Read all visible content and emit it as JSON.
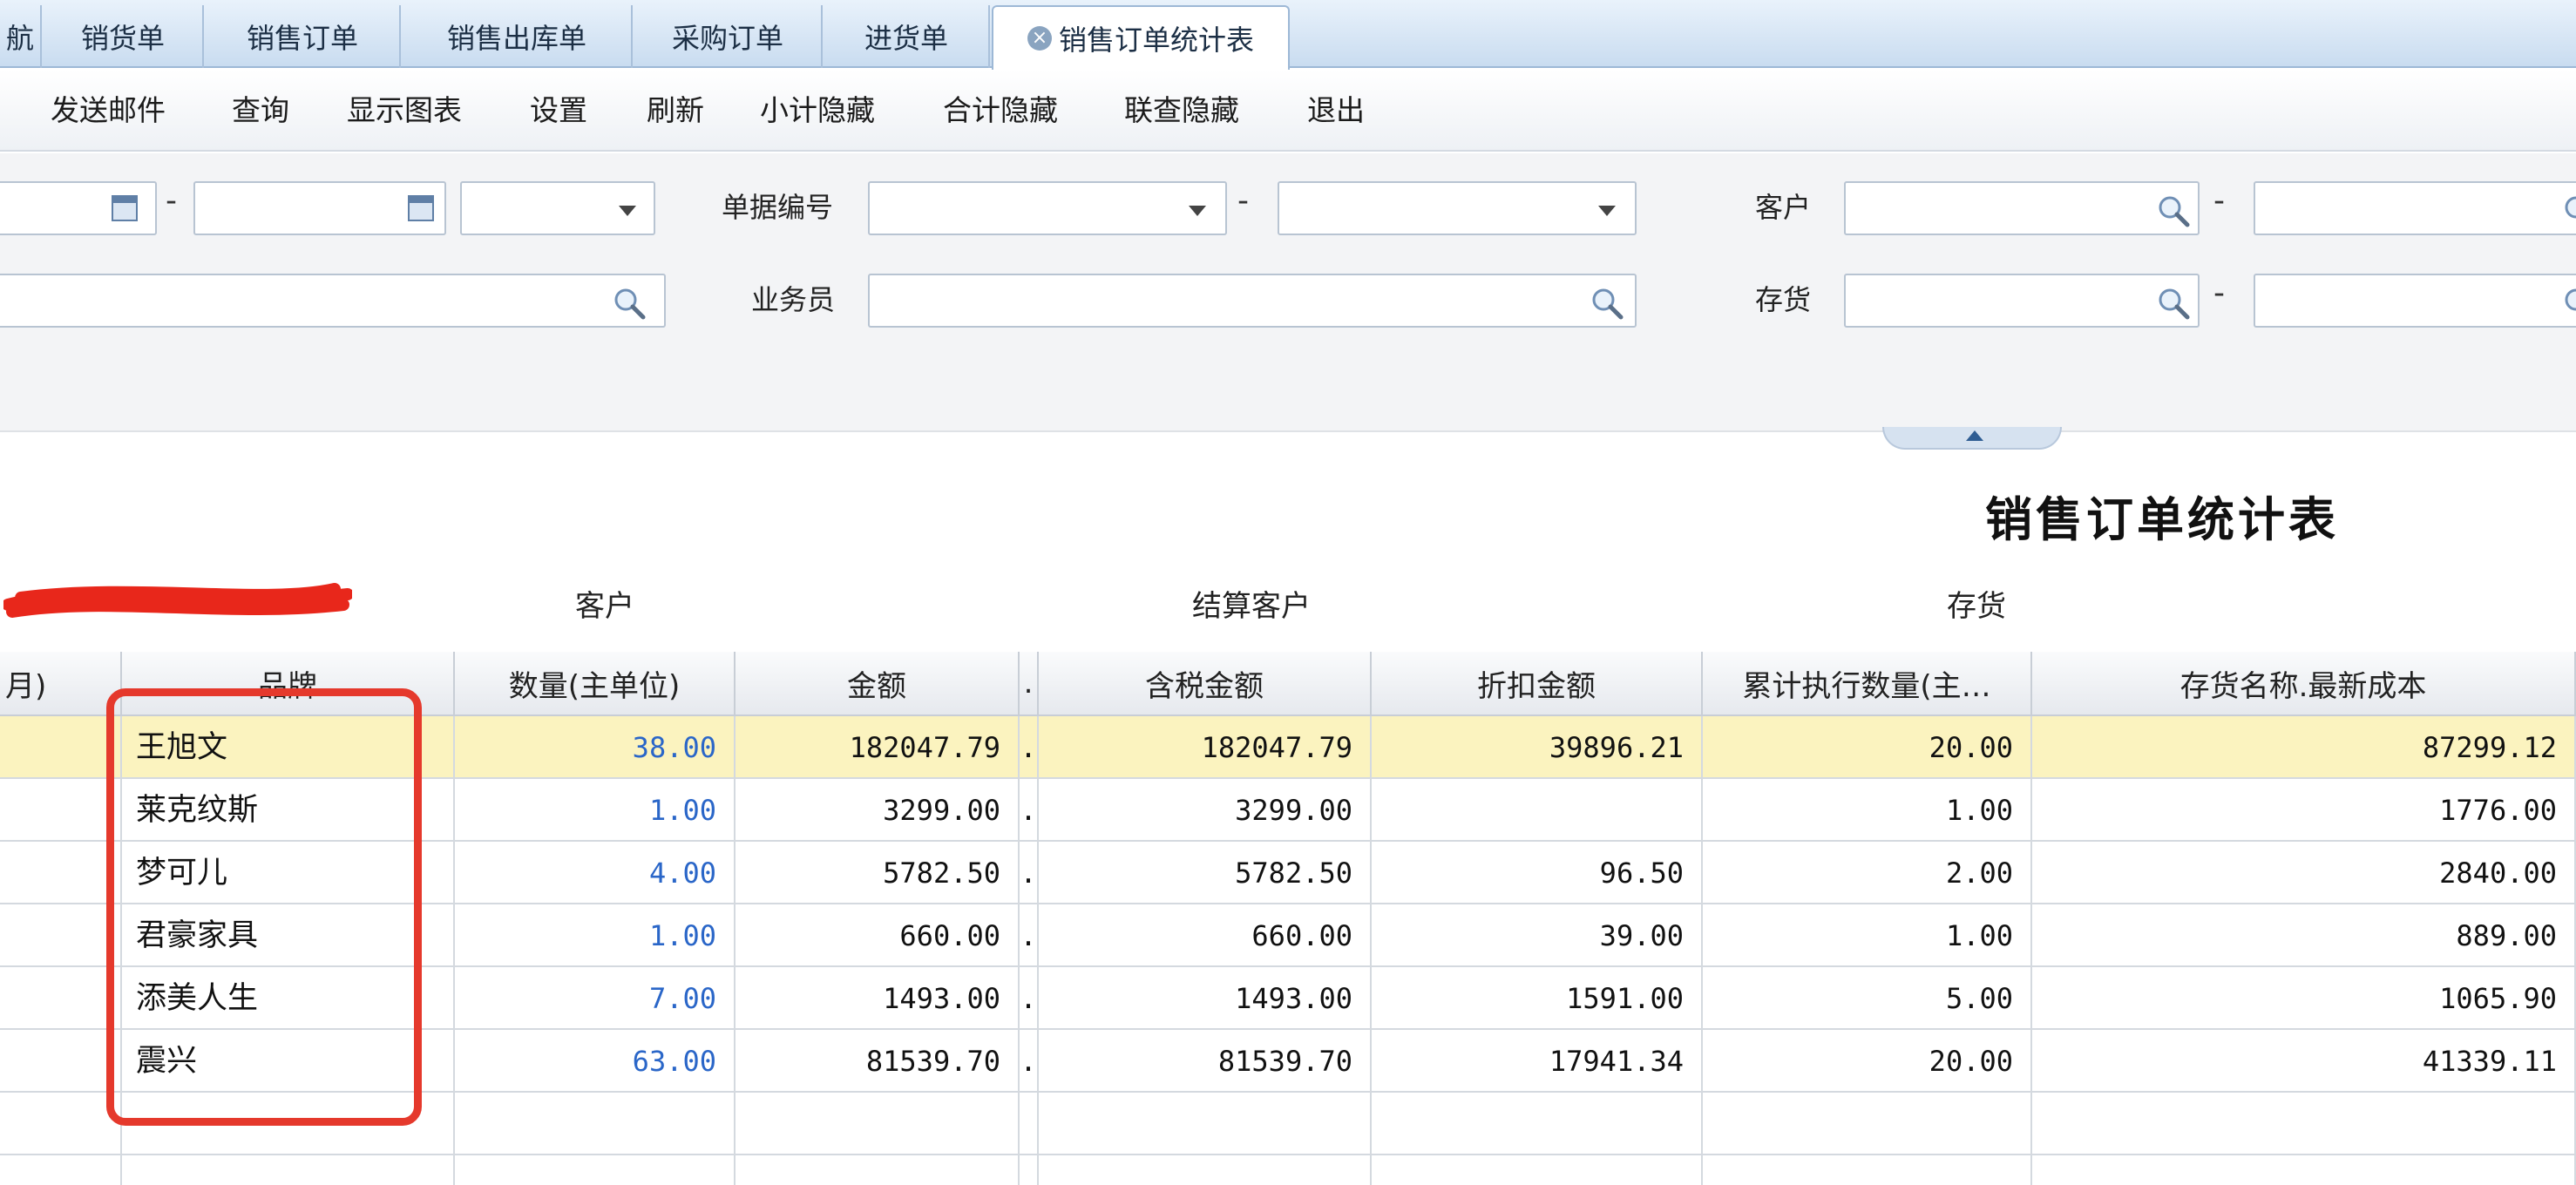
{
  "tabs": [
    {
      "label": "航"
    },
    {
      "label": "销货单"
    },
    {
      "label": "销售订单"
    },
    {
      "label": "销售出库单"
    },
    {
      "label": "采购订单"
    },
    {
      "label": "进货单"
    },
    {
      "label": "销售订单统计表"
    }
  ],
  "toolbar": [
    "发送邮件",
    "查询",
    "显示图表",
    "设置",
    "刷新",
    "小计隐藏",
    "合计隐藏",
    "联查隐藏",
    "退出"
  ],
  "filter": {
    "doc_no_label": "单据编号",
    "salesperson_label": "业务员",
    "customer_label": "客户",
    "inventory_label": "存货",
    "dash": "-"
  },
  "report": {
    "title": "销售订单统计表",
    "group_customer": "客户",
    "group_settle_customer": "结算客户",
    "group_inventory": "存货"
  },
  "table": {
    "columns": [
      "月)",
      "品牌",
      "数量(主单位)",
      "金额",
      ".",
      "含税金额",
      "折扣金额",
      "累计执行数量(主…",
      "存货名称.最新成本"
    ],
    "rows": [
      {
        "brand": "王旭文",
        "qty": "38.00",
        "amount": "182047.79",
        "tax_amount": "182047.79",
        "discount": "39896.21",
        "executed": "20.00",
        "cost": "87299.12"
      },
      {
        "brand": "莱克纹斯",
        "qty": "1.00",
        "amount": "3299.00",
        "tax_amount": "3299.00",
        "discount": "",
        "executed": "1.00",
        "cost": "1776.00"
      },
      {
        "brand": "梦可儿",
        "qty": "4.00",
        "amount": "5782.50",
        "tax_amount": "5782.50",
        "discount": "96.50",
        "executed": "2.00",
        "cost": "2840.00"
      },
      {
        "brand": "君豪家具",
        "qty": "1.00",
        "amount": "660.00",
        "tax_amount": "660.00",
        "discount": "39.00",
        "executed": "1.00",
        "cost": "889.00"
      },
      {
        "brand": "添美人生",
        "qty": "7.00",
        "amount": "1493.00",
        "tax_amount": "1493.00",
        "discount": "1591.00",
        "executed": "5.00",
        "cost": "1065.90"
      },
      {
        "brand": "震兴",
        "qty": "63.00",
        "amount": "81539.70",
        "tax_amount": "81539.70",
        "discount": "17941.34",
        "executed": "20.00",
        "cost": "41339.11"
      }
    ]
  },
  "colors": {
    "tab_bg": "#c9dcf0",
    "selected_row": "#fbf3bf",
    "qty_blue": "#2a66c8",
    "annotation_red": "#e5392c"
  }
}
